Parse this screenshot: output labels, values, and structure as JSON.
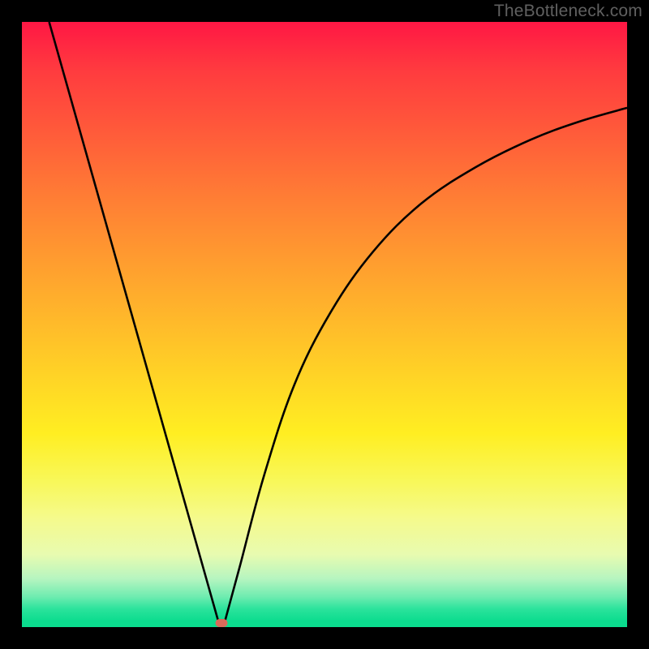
{
  "watermark": "TheBottleneck.com",
  "chart_data": {
    "type": "line",
    "title": "",
    "xlabel": "",
    "ylabel": "",
    "xlim": [
      0,
      100
    ],
    "ylim": [
      0,
      100
    ],
    "grid": false,
    "legend": false,
    "series": [
      {
        "name": "left-branch",
        "x": [
          4.5,
          32.5
        ],
        "y": [
          100,
          0.8
        ]
      },
      {
        "name": "right-branch",
        "x": [
          33.5,
          36,
          40,
          45,
          51,
          58,
          66,
          75,
          84,
          92,
          100
        ],
        "y": [
          0.8,
          10,
          25,
          40,
          52,
          62,
          70,
          76,
          80.5,
          83.5,
          85.8
        ]
      }
    ],
    "marker": {
      "x": 33,
      "y": 0.7,
      "color": "#d96a5a"
    },
    "gradient_stops": [
      {
        "pos": 0,
        "color": "#ff1744"
      },
      {
        "pos": 68,
        "color": "#ffee22"
      },
      {
        "pos": 100,
        "color": "#0bdc8e"
      }
    ]
  }
}
